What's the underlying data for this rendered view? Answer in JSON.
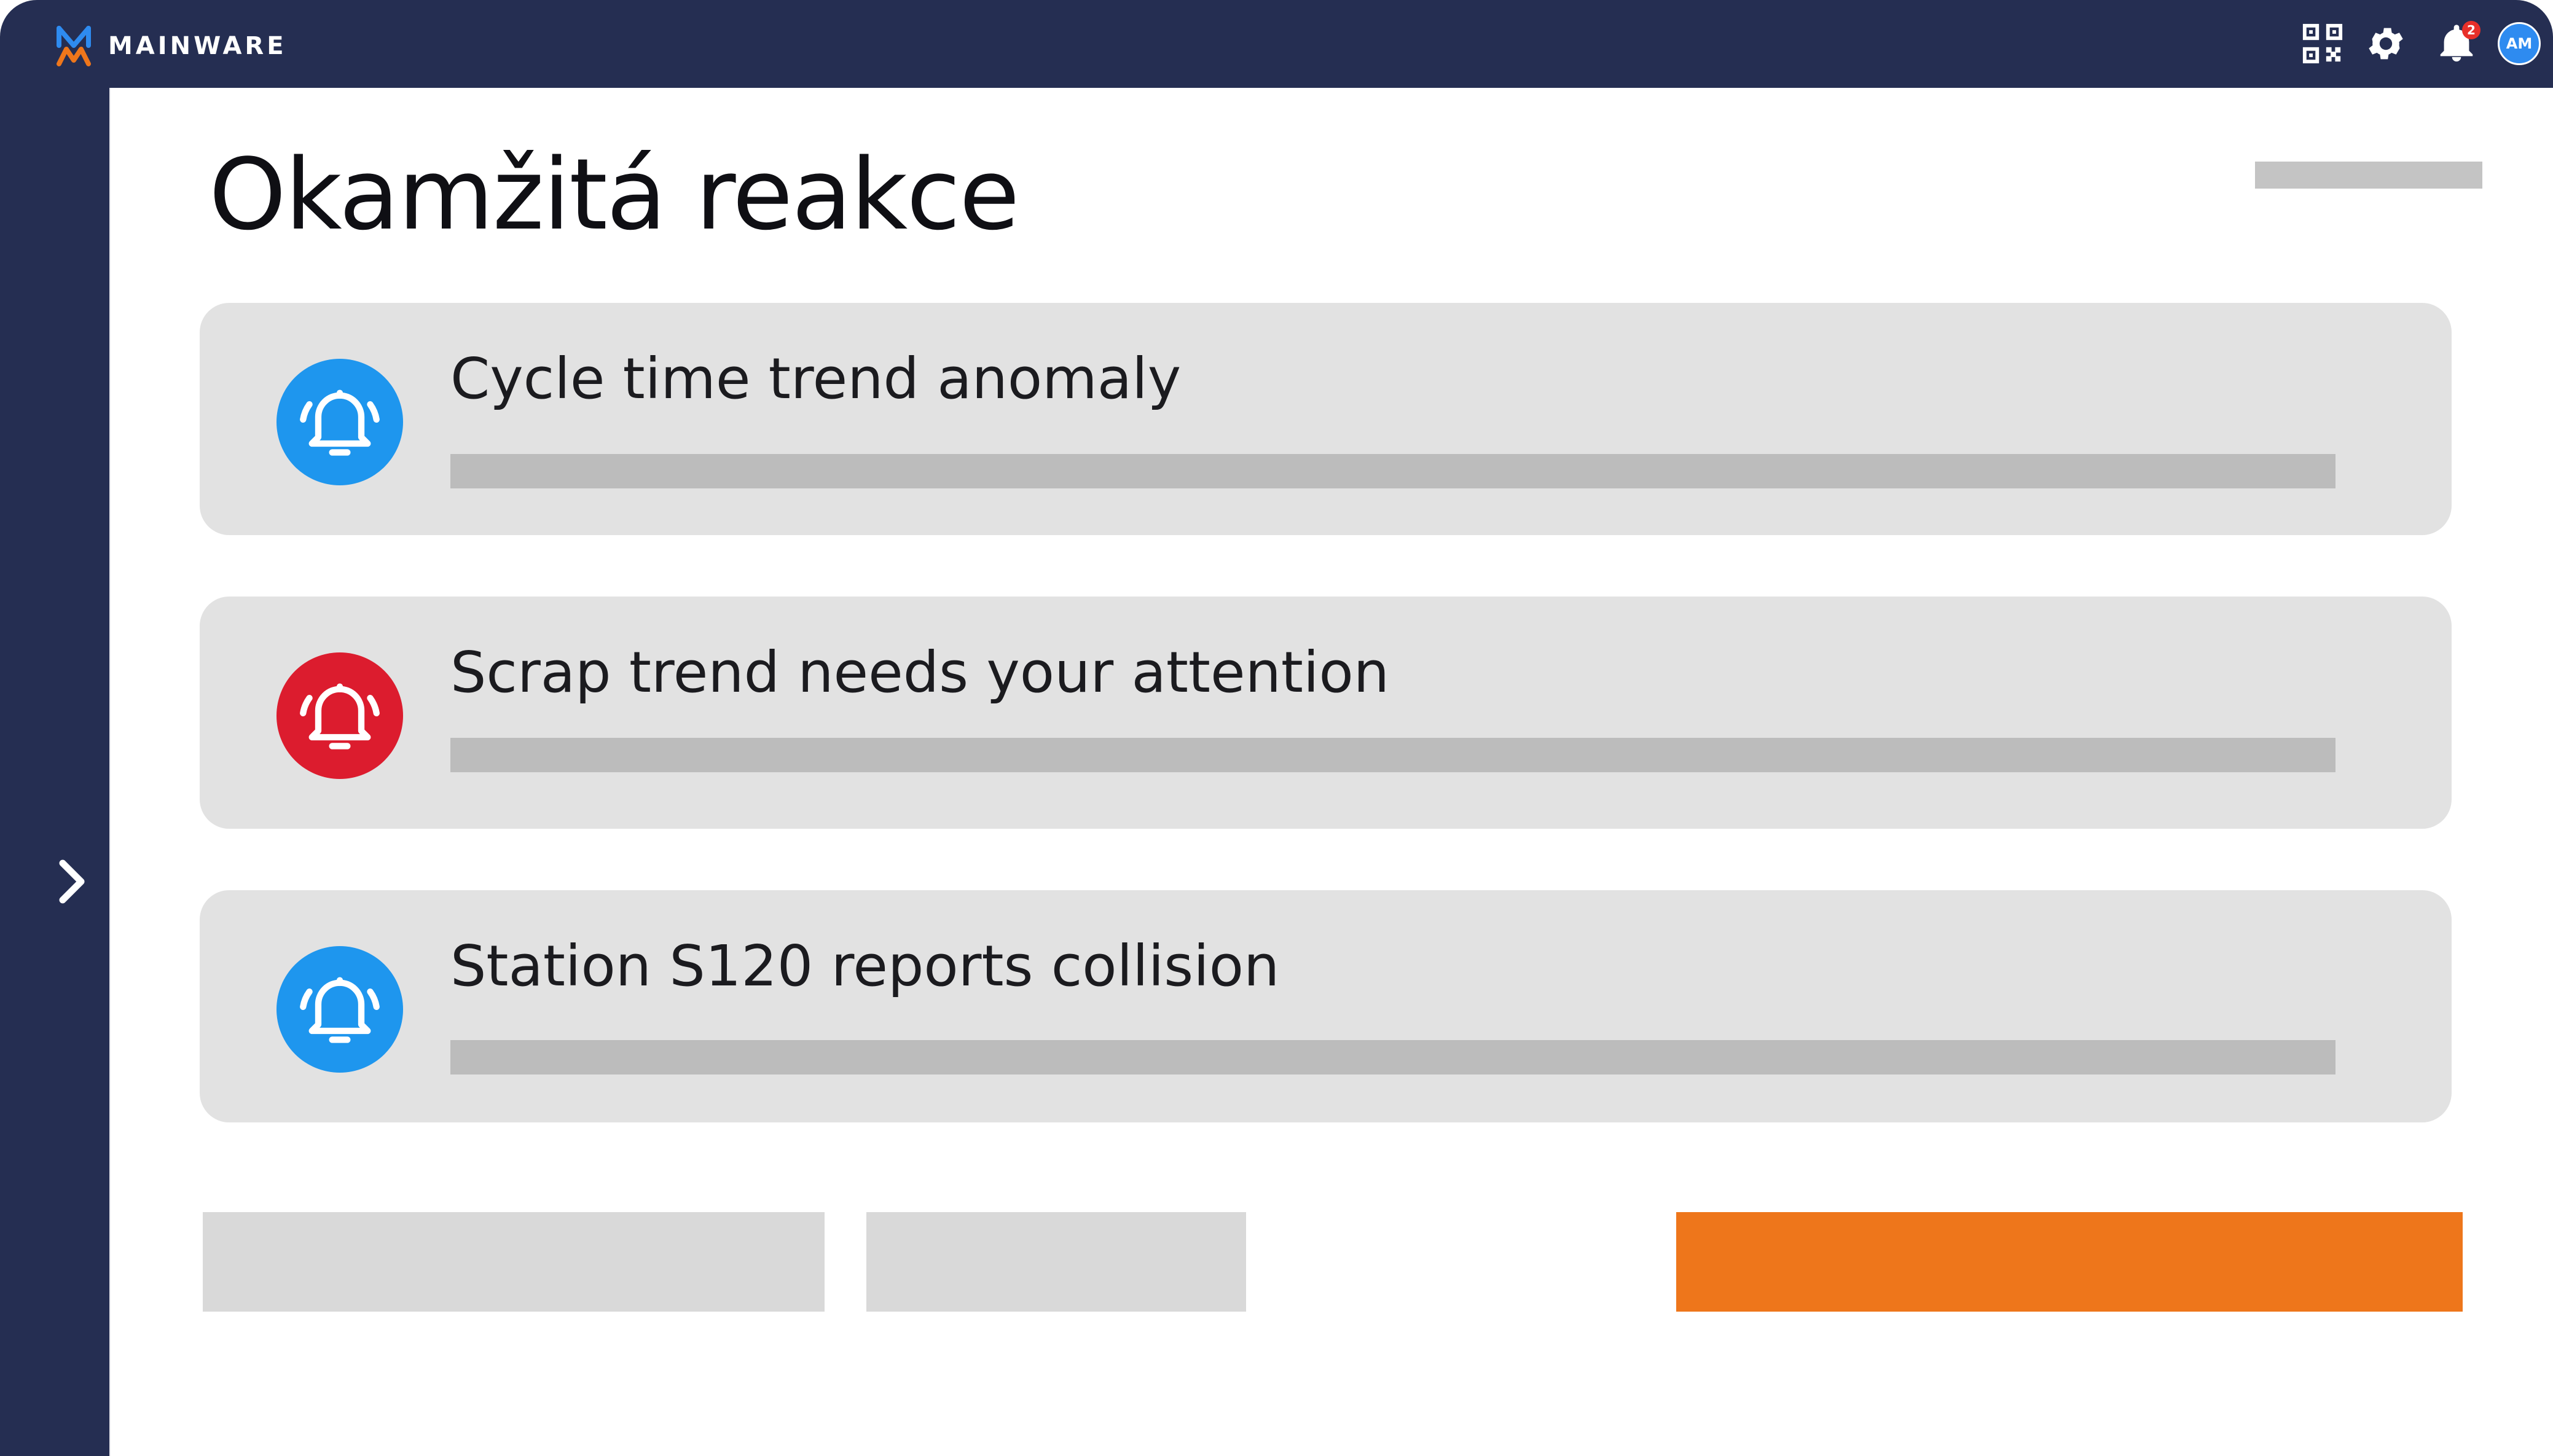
{
  "app": {
    "brand": "MAINWARE",
    "brand_colors": {
      "logo_primary": "#2e8bf0",
      "logo_accent": "#ee761b",
      "frame": "#252e52"
    }
  },
  "header": {
    "icons": [
      "qr-code-icon",
      "gear-icon",
      "bell-icon",
      "avatar"
    ],
    "notification_count": "2",
    "avatar_initials": "AM"
  },
  "sidebar": {
    "toggle_icon": "chevron-right-icon"
  },
  "page": {
    "title": "Okamžitá reakce"
  },
  "alerts": [
    {
      "title": "Cycle time trend anomaly",
      "icon": "bell-icon",
      "color": "#1e96ee"
    },
    {
      "title": "Scrap trend needs your attention",
      "icon": "bell-icon",
      "color": "#dc1c2e"
    },
    {
      "title": "Station S120 reports collision",
      "icon": "bell-icon",
      "color": "#1e96ee"
    }
  ],
  "actions": {
    "primary_color": "#ee761b",
    "secondary_color": "#d9d9d9"
  }
}
